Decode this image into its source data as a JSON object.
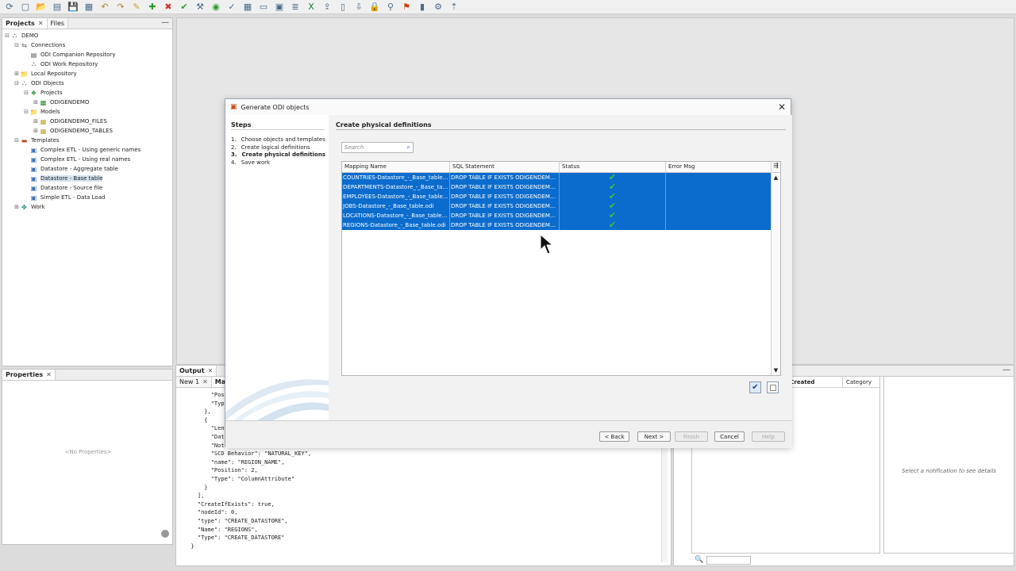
{
  "toolbar": {
    "icons": [
      "refresh-icon",
      "new-icon",
      "open-icon",
      "new-file-icon",
      "save-icon",
      "save-all-icon",
      "undo-icon",
      "redo-icon",
      "pencil-icon",
      "add-icon",
      "delete-icon",
      "validate-icon",
      "tools-icon",
      "run-icon",
      "check-icon",
      "table-icon",
      "form-icon",
      "view-icon",
      "list-icon",
      "excel-icon",
      "export-icon",
      "document-icon",
      "import-icon",
      "lock-icon",
      "model-icon",
      "flag-icon",
      "bookmark-icon",
      "settings-icon",
      "pin-icon"
    ]
  },
  "navigator": {
    "tabs": [
      {
        "label": "Projects"
      },
      {
        "label": "Files"
      }
    ],
    "tree": [
      {
        "label": "DEMO",
        "indent": 0,
        "exp": "−",
        "icon": "root-icon"
      },
      {
        "label": "Connections",
        "indent": 1,
        "exp": "−",
        "icon": "connections-icon"
      },
      {
        "label": "ODI Companion Repository",
        "indent": 2,
        "exp": "",
        "icon": "repository-icon"
      },
      {
        "label": "ODI Work Repository",
        "indent": 2,
        "exp": "",
        "icon": "work-repository-icon"
      },
      {
        "label": "Local Repository",
        "indent": 1,
        "exp": "+",
        "icon": "folder-icon"
      },
      {
        "label": "ODI Objects",
        "indent": 1,
        "exp": "−",
        "icon": "odi-objects-icon"
      },
      {
        "label": "Projects",
        "indent": 2,
        "exp": "−",
        "icon": "projects-icon"
      },
      {
        "label": "ODIGENDEMO",
        "indent": 3,
        "exp": "+",
        "icon": "project-icon"
      },
      {
        "label": "Models",
        "indent": 2,
        "exp": "−",
        "icon": "models-icon"
      },
      {
        "label": "ODIGENDEMO_FILES",
        "indent": 3,
        "exp": "+",
        "icon": "model-icon"
      },
      {
        "label": "ODIGENDEMO_TABLES",
        "indent": 3,
        "exp": "+",
        "icon": "model-icon"
      },
      {
        "label": "Templates",
        "indent": 1,
        "exp": "−",
        "icon": "templates-icon"
      },
      {
        "label": "Complex ETL - Using  generic names",
        "indent": 2,
        "exp": "",
        "icon": "template-icon"
      },
      {
        "label": "Complex ETL - Using real names",
        "indent": 2,
        "exp": "",
        "icon": "template-icon"
      },
      {
        "label": "Datastore - Aggregate table",
        "indent": 2,
        "exp": "",
        "icon": "template-icon"
      },
      {
        "label": "Datastore - Base table",
        "indent": 2,
        "exp": "",
        "icon": "template-icon",
        "selected": true
      },
      {
        "label": "Datastore - Source file",
        "indent": 2,
        "exp": "",
        "icon": "template-icon"
      },
      {
        "label": "Simple ETL - Data Load",
        "indent": 2,
        "exp": "",
        "icon": "template-icon"
      },
      {
        "label": "Work",
        "indent": 1,
        "exp": "+",
        "icon": "work-icon"
      }
    ]
  },
  "properties": {
    "tab": "Properties",
    "empty": "<No Properties>"
  },
  "output": {
    "tab": "Output",
    "subtabs": [
      {
        "label": "New 1"
      },
      {
        "label": "Mapp"
      }
    ],
    "lines": [
      "        \"Pos",
      "        \"Typ",
      "      },",
      "      {",
      "        \"Len",
      "        \"Dat",
      "        \"Not",
      "        \"SCD Behavior\": \"NATURAL_KEY\",",
      "        \"name\": \"REGION_NAME\",",
      "        \"Position\": 2,",
      "        \"Type\": \"ColumnAttribute\"",
      "      }",
      "    ],",
      "    \"CreateIfExists\": true,",
      "    \"nodeId\": 0,",
      "    \"type\": \"CREATE_DATASTORE\",",
      "    \"Name\": \"REGIONS\",",
      "    \"Type\": \"CREATE_DATASTORE\"",
      "  }"
    ]
  },
  "notifications": {
    "col_date": "ate Created",
    "col_category": "Category",
    "detail_hint": "Select a notification to see details"
  },
  "dialog": {
    "title": "Generate ODI objects",
    "steps_title": "Steps",
    "steps": [
      {
        "num": "1.",
        "label": "Choose objects and templates"
      },
      {
        "num": "2.",
        "label": "Create logical definitions"
      },
      {
        "num": "3.",
        "label": "Create physical definitions",
        "current": true
      },
      {
        "num": "4.",
        "label": "Save work"
      }
    ],
    "section_title": "Create physical definitions",
    "search_placeholder": "Search",
    "columns": [
      "Mapping Name",
      "SQL Statement",
      "Status",
      "Error Msg"
    ],
    "rows": [
      {
        "name": "COUNTRIES-Datastore_-_Base_table.odi",
        "sql": "DROP TABLE IF EXISTS ODIGENDEMO_...",
        "status": "ok",
        "error": ""
      },
      {
        "name": "DEPARTMENTS-Datastore_-_Base_tabl...",
        "sql": "DROP TABLE IF EXISTS ODIGENDEMO_...",
        "status": "ok",
        "error": ""
      },
      {
        "name": "EMPLOYEES-Datastore_-_Base_table.odi",
        "sql": "DROP TABLE IF EXISTS ODIGENDEMO_...",
        "status": "ok",
        "error": ""
      },
      {
        "name": "JOBS-Datastore_-_Base_table.odi",
        "sql": "DROP TABLE IF EXISTS ODIGENDEMO_...",
        "status": "ok",
        "error": ""
      },
      {
        "name": "LOCATIONS-Datastore_-_Base_table.odi",
        "sql": "DROP TABLE IF EXISTS ODIGENDEMO_...",
        "status": "ok",
        "error": ""
      },
      {
        "name": "REGIONS-Datastore_-_Base_table.odi",
        "sql": "DROP TABLE IF EXISTS ODIGENDEMO_...",
        "status": "ok",
        "error": ""
      }
    ],
    "buttons": {
      "back": "< Back",
      "next": "Next >",
      "finish": "Finish",
      "cancel": "Cancel",
      "help": "Help"
    }
  },
  "colors": {
    "selection": "#0b6ccd",
    "check": "#40c040"
  }
}
